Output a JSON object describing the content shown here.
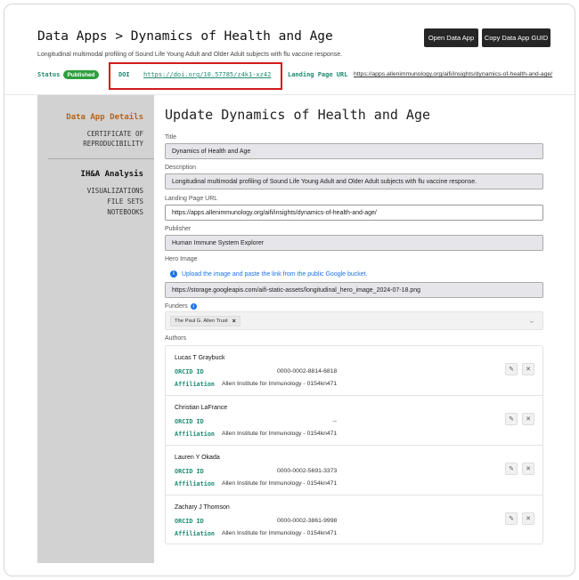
{
  "breadcrumb": {
    "parent": "Data Apps",
    "separator": ">",
    "current": "Dynamics of Health and Age"
  },
  "subtitle": "Longitudinal multimodal profiling of Sound Life Young Adult and Older Adult subjects with flu vaccine response.",
  "actions": {
    "open": "Open Data App",
    "copy_guid": "Copy Data App GUID"
  },
  "meta": {
    "status_label": "Status",
    "status_value": "Published",
    "doi_label": "DOI",
    "doi_value": "https://doi.org/10.57785/z4k1-xz42",
    "landing_label": "Landing Page URL",
    "landing_value": "https://apps.allenimmunology.org/aifi/insights/dynamics-of-health-and-age/"
  },
  "sidebar": {
    "section1_title": "Data App Details",
    "cert_line1": "CERTIFICATE OF",
    "cert_line2": "REPRODUCIBILITY",
    "section2_title": "IH&A Analysis",
    "items": [
      "VISUALIZATIONS",
      "FILE SETS",
      "NOTEBOOKS"
    ]
  },
  "form": {
    "heading": "Update Dynamics of Health and Age",
    "title_label": "Title",
    "title_value": "Dynamics of Health and Age",
    "description_label": "Description",
    "description_value": "Longitudinal multimodal profiling of Sound Life Young Adult and Older Adult subjects with flu vaccine response.",
    "landing_label": "Landing Page URL",
    "landing_value": "https://apps.allenimmunology.org/aifi/insights/dynamics-of-health-and-age/",
    "publisher_label": "Publisher",
    "publisher_value": "Human Immune System Explorer",
    "hero_label": "Hero Image",
    "hero_hint": "Upload the image and paste the link from the public Google bucket.",
    "hero_value": "https://storage.googleapis.com/aifi-static-assets/longitudinal_hero_image_2024-07-18.png",
    "funders_label": "Funders",
    "funder_tag": "The Paul G. Allen Trust",
    "authors_label": "Authors"
  },
  "authors": [
    {
      "name": "Lucas T Graybuck",
      "orcid_label": "ORCID ID",
      "orcid": "0000-0002-8814-6818",
      "aff_label": "Affiliation",
      "affiliation": "Allen Institute for Immunology - 0154kn471"
    },
    {
      "name": "Christian LaFrance",
      "orcid_label": "ORCID ID",
      "orcid": "--",
      "aff_label": "Affiliation",
      "affiliation": "Allen Institute for Immunology - 0154kn471"
    },
    {
      "name": "Lauren Y Okada",
      "orcid_label": "ORCID ID",
      "orcid": "0000-0002-5691-3373",
      "aff_label": "Affiliation",
      "affiliation": "Allen Institute for Immunology - 0154kn471"
    },
    {
      "name": "Zachary J Thomson",
      "orcid_label": "ORCID ID",
      "orcid": "0000-0002-3861-9998",
      "aff_label": "Affiliation",
      "affiliation": "Allen Institute for Immunology - 0154kn471"
    }
  ],
  "colors": {
    "accent_teal": "#1f8a70",
    "sidebar_accent": "#b5651d",
    "published": "#2e9e3e",
    "link_blue": "#1a73e8",
    "highlight_red": "#d11a1a"
  }
}
